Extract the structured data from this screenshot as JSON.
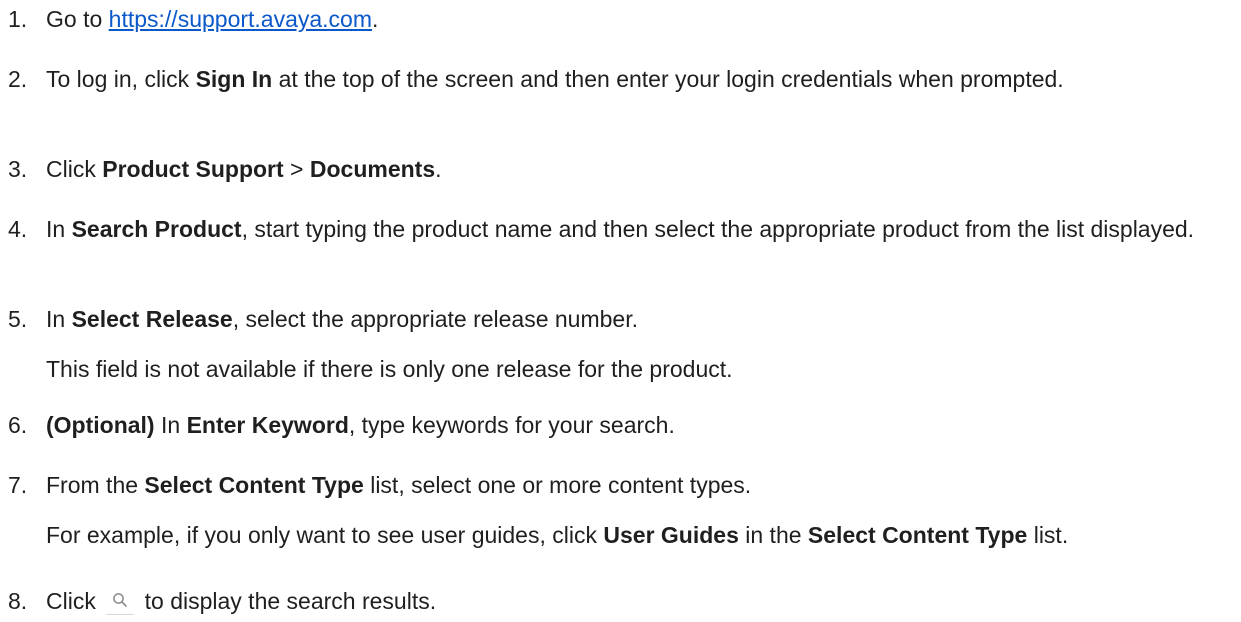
{
  "steps": [
    {
      "num": "1.",
      "pre": "Go to ",
      "link": "https://support.avaya.com",
      "post": "."
    },
    {
      "num": "2.",
      "pre": "To log in, click ",
      "b1": "Sign In",
      "mid": " at the top of the screen and then enter your login credentials when prompted."
    },
    {
      "num": "3.",
      "pre": "Click ",
      "b1": "Product Support",
      "sep": " > ",
      "b2": "Documents",
      "post": "."
    },
    {
      "num": "4.",
      "pre": "In ",
      "b1": "Search Product",
      "post": ", start typing the product name and then select the appropriate product from the list displayed."
    },
    {
      "num": "5.",
      "pre": "In ",
      "b1": "Select Release",
      "post": ", select the appropriate release number.",
      "note": "This field is not available if there is only one release for the product."
    },
    {
      "num": "6.",
      "b0": "(Optional)",
      "pre": " In ",
      "b1": "Enter Keyword",
      "post": ", type keywords for your search."
    },
    {
      "num": "7.",
      "pre": "From the ",
      "b1": "Select Content Type",
      "post": " list, select one or more content types.",
      "note_pre": "For example, if you only want to see user guides, click ",
      "note_b1": "User Guides",
      "note_mid": " in the ",
      "note_b2": "Select Content Type",
      "note_post": " list."
    },
    {
      "num": "8.",
      "pre": "Click ",
      "icon": "search-icon",
      "post": " to display the search results."
    }
  ]
}
